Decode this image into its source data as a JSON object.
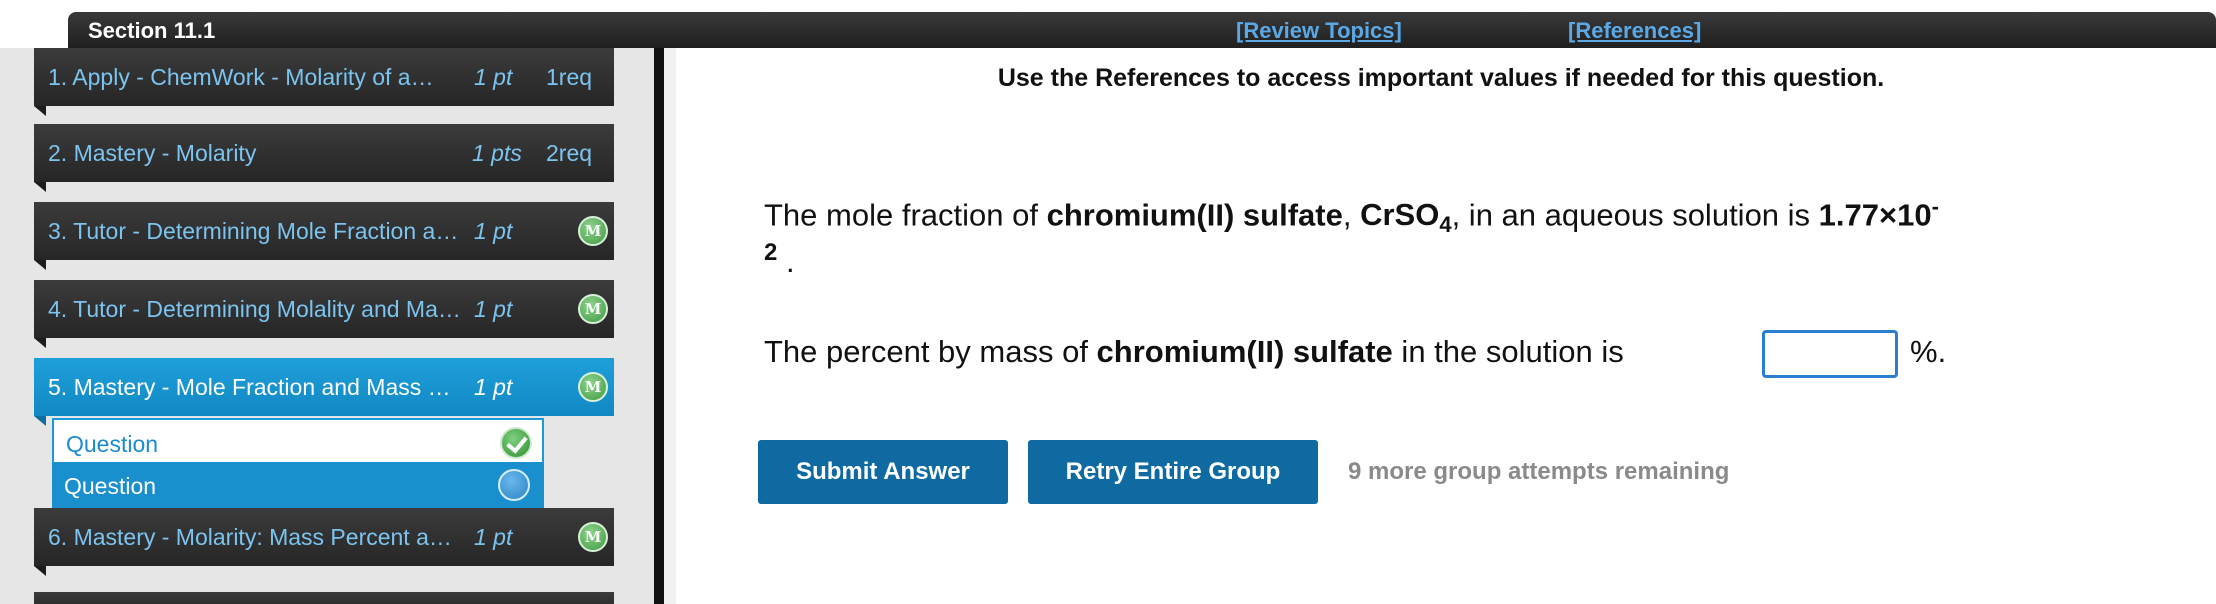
{
  "header": {
    "section_title": "Section 11.1",
    "review_topics_label": "[Review Topics]",
    "references_label": "[References]"
  },
  "sidebar": {
    "items": [
      {
        "label": "1. Apply - ChemWork - Molarity of a…",
        "points": "1 pt",
        "req": "1req"
      },
      {
        "label": "2. Mastery - Molarity",
        "points": "1 pts",
        "req": "2req"
      },
      {
        "label": "3. Tutor - Determining Mole Fraction a…",
        "points": "1 pt",
        "badge": "M"
      },
      {
        "label": "4. Tutor - Determining Molality and Ma…",
        "points": "1 pt",
        "badge": "M"
      },
      {
        "label": "5. Mastery - Mole Fraction and Mass …",
        "points": "1 pt",
        "badge": "M"
      },
      {
        "label": "6. Mastery - Molarity: Mass Percent a…",
        "points": "1 pt",
        "badge": "M"
      }
    ],
    "sub_items": [
      {
        "label": "Question",
        "status": "correct"
      },
      {
        "label": "Question",
        "status": "current"
      }
    ]
  },
  "main": {
    "references_note": "Use the References to access important values if needed for this question.",
    "q1_pre": "The mole fraction of ",
    "q1_compound": "chromium(II) sulfate",
    "q1_comma": ", ",
    "q1_formula_pre": "CrSO",
    "q1_formula_sub": "4",
    "q1_mid": ", in an aqueous solution is ",
    "q1_value": "1.77×10",
    "q1_exp_part1": "-",
    "q1_exp_part2": "2",
    "q1_end": " .",
    "q2_pre": "The percent by mass of ",
    "q2_compound": "chromium(II) sulfate",
    "q2_mid": " in the solution is",
    "answer_value": "",
    "percent_sign": "%.",
    "submit_label": "Submit Answer",
    "retry_label": "Retry Entire Group",
    "attempts_text": "9 more group attempts remaining"
  }
}
